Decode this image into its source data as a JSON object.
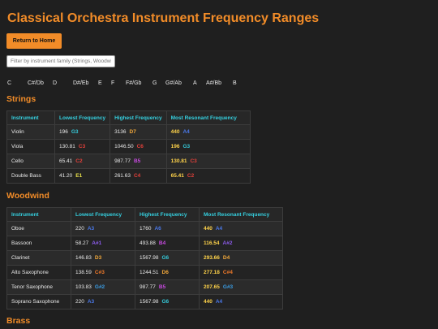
{
  "title": "Classical Orchestra Instrument Frequency Ranges",
  "home_button": "Return to Home",
  "filter": {
    "placeholder": "Filter by instrument family (Strings, Woodwind, Brass...)",
    "value": ""
  },
  "notes": [
    "C",
    "C#/Db",
    "D",
    "D#/Eb",
    "E",
    "F",
    "F#/Gb",
    "G",
    "G#/Ab",
    "A",
    "A#/Bb",
    "B"
  ],
  "note_colors": {
    "C": "#e2403a",
    "C#": "#f07a2a",
    "D": "#f2a83a",
    "D#": "#f2c94a",
    "E": "#e8e04a",
    "F": "#8fd13a",
    "F#": "#3ac46a",
    "G": "#35c8d8",
    "G#": "#3a9ae0",
    "A": "#4a78e8",
    "A#": "#8a5ae8",
    "B": "#c84ae0"
  },
  "columns": [
    "Instrument",
    "Lowest Frequency",
    "Highest Frequency",
    "Most Resonant Frequency"
  ],
  "sections": [
    {
      "name": "Strings",
      "rows": [
        {
          "instrument": "Violin",
          "low": [
            "196",
            "G3"
          ],
          "high": [
            "3136",
            "D7"
          ],
          "res": [
            "440",
            "A4"
          ]
        },
        {
          "instrument": "Viola",
          "low": [
            "130.81",
            "C3"
          ],
          "high": [
            "1046.50",
            "C6"
          ],
          "res": [
            "196",
            "G3"
          ]
        },
        {
          "instrument": "Cello",
          "low": [
            "65.41",
            "C2"
          ],
          "high": [
            "987.77",
            "B5"
          ],
          "res": [
            "130.81",
            "C3"
          ]
        },
        {
          "instrument": "Double Bass",
          "low": [
            "41.20",
            "E1"
          ],
          "high": [
            "261.63",
            "C4"
          ],
          "res": [
            "65.41",
            "C2"
          ]
        }
      ]
    },
    {
      "name": "Woodwind",
      "rows": [
        {
          "instrument": "Oboe",
          "low": [
            "220",
            "A3"
          ],
          "high": [
            "1760",
            "A6"
          ],
          "res": [
            "440",
            "A4"
          ]
        },
        {
          "instrument": "Bassoon",
          "low": [
            "58.27",
            "A#1"
          ],
          "high": [
            "493.88",
            "B4"
          ],
          "res": [
            "116.54",
            "A#2"
          ]
        },
        {
          "instrument": "Clarinet",
          "low": [
            "146.83",
            "D3"
          ],
          "high": [
            "1567.98",
            "G6"
          ],
          "res": [
            "293.66",
            "D4"
          ]
        },
        {
          "instrument": "Alto Saxophone",
          "low": [
            "138.59",
            "C#3"
          ],
          "high": [
            "1244.51",
            "D6"
          ],
          "res": [
            "277.18",
            "C#4"
          ]
        },
        {
          "instrument": "Tenor Saxophone",
          "low": [
            "103.83",
            "G#2"
          ],
          "high": [
            "987.77",
            "B5"
          ],
          "res": [
            "207.65",
            "G#3"
          ]
        },
        {
          "instrument": "Soprano Saxophone",
          "low": [
            "220",
            "A3"
          ],
          "high": [
            "1567.98",
            "G6"
          ],
          "res": [
            "440",
            "A4"
          ]
        }
      ]
    },
    {
      "name": "Brass",
      "rows": []
    }
  ]
}
